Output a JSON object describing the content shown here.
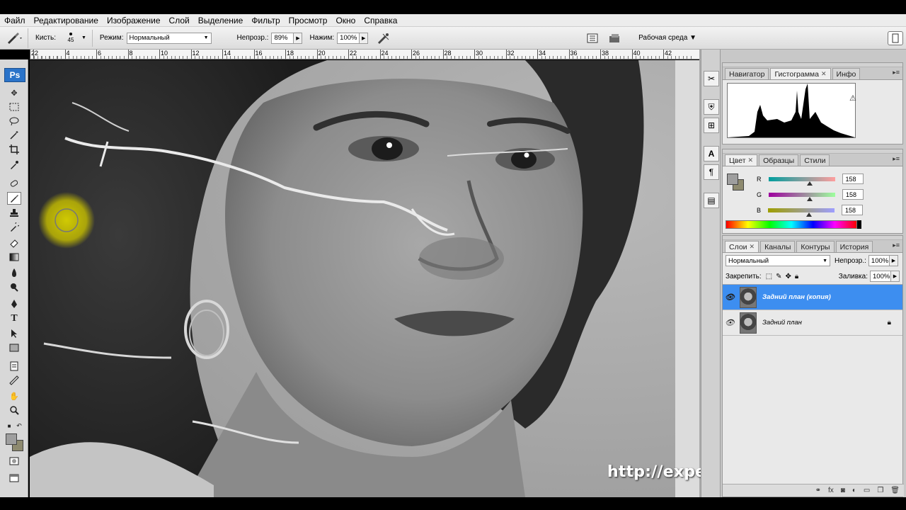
{
  "menu": [
    "Файл",
    "Редактирование",
    "Изображение",
    "Слой",
    "Выделение",
    "Фильтр",
    "Просмотр",
    "Окно",
    "Справка"
  ],
  "options": {
    "brushes_label": "Кисть:",
    "brush_size": "45",
    "mode_label": "Режим:",
    "mode_value": "Нормальный",
    "opacity_label": "Непрозр.:",
    "opacity_value": "89%",
    "flow_label": "Нажим:",
    "flow_value": "100%",
    "workspace_label": "Рабочая среда ▼"
  },
  "ruler": {
    "numbers": [
      "2",
      "2",
      "4",
      "6",
      "8",
      "10",
      "12",
      "14",
      "16",
      "18",
      "20",
      "22",
      "24",
      "26",
      "28",
      "30",
      "32",
      "34",
      "36",
      "38",
      "40",
      "42"
    ]
  },
  "toolbox": {
    "logo": "Ps"
  },
  "watermark": "http://expert-polygraphy.com",
  "panels": {
    "top_tabs": {
      "navigator": "Навигатор",
      "histogram": "Гистограмма",
      "info": "Инфо"
    },
    "color_tabs": {
      "color": "Цвет",
      "swatches": "Образцы",
      "styles": "Стили"
    },
    "color": {
      "r_label": "R",
      "r_value": "158",
      "g_label": "G",
      "g_value": "158",
      "b_label": "B",
      "b_value": "158",
      "fg_color": "#9e9e9e",
      "bg_color": "#8e8a6f"
    },
    "layers_tabs": {
      "layers": "Слои",
      "channels": "Каналы",
      "paths": "Контуры",
      "history": "История"
    },
    "layers": {
      "blend_mode": "Нормальный",
      "opacity_label": "Непрозр.:",
      "opacity_value": "100%",
      "lock_label": "Закрепить:",
      "fill_label": "Заливка:",
      "fill_value": "100%",
      "items": [
        {
          "name": "Задний план (копия)",
          "selected": true
        },
        {
          "name": "Задний план",
          "selected": false
        }
      ]
    }
  },
  "accent_color": "#3d8ef0"
}
